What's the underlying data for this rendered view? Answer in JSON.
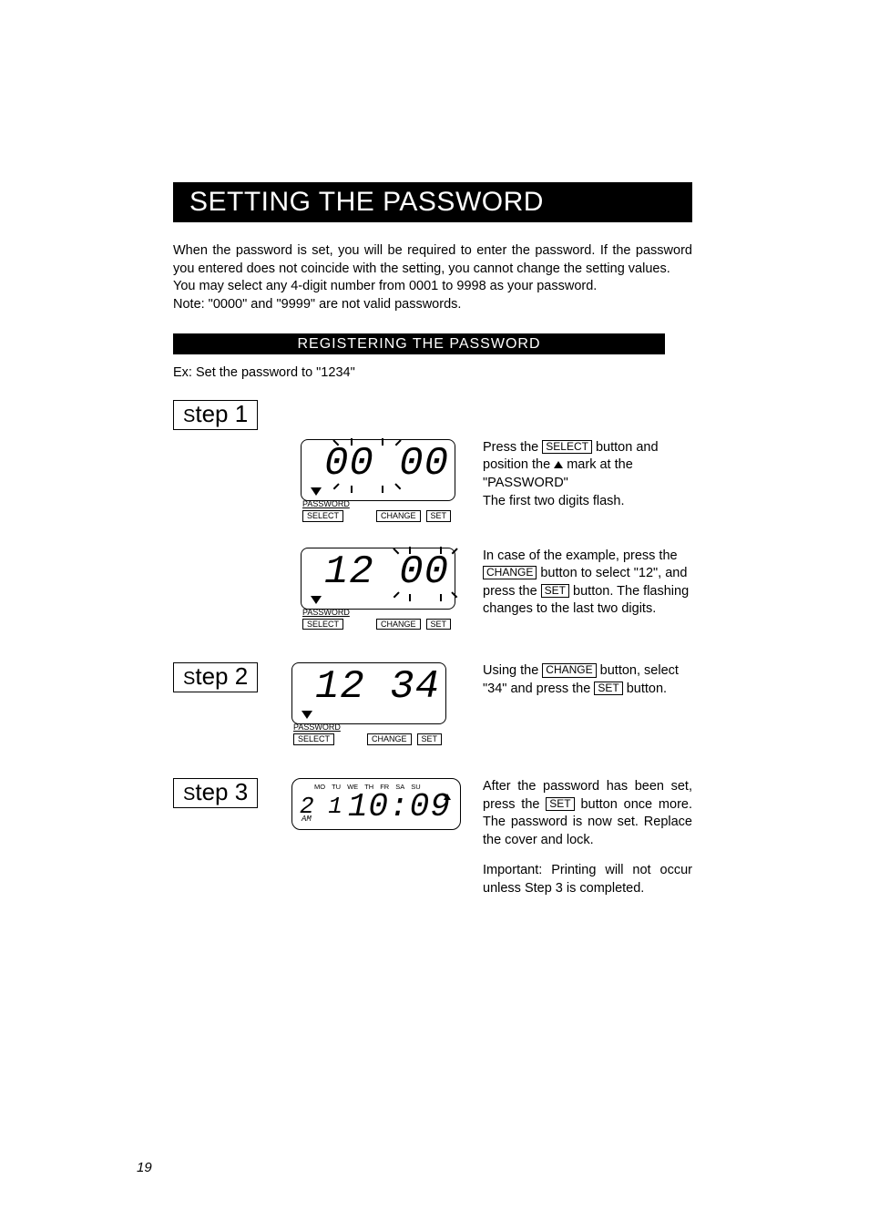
{
  "page_number": "19",
  "title": "SETTING THE PASSWORD",
  "intro": {
    "p1": "When the password is set, you will be required to enter the password. If the password you entered does not coincide with the setting, you cannot change the setting values.",
    "p2": "You may select any 4-digit number from 0001 to 9998 as your password.",
    "p3": "Note: \"0000\" and \"9999\" are not valid passwords."
  },
  "subheading": "REGISTERING THE PASSWORD",
  "example_line": "Ex: Set the password to \"1234\"",
  "steps": {
    "s1_label_prefix": "S",
    "s1_label_rest": "tep 1",
    "s2_label_prefix": "S",
    "s2_label_rest": "tep 2",
    "s3_label_prefix": "S",
    "s3_label_rest": "tep 3"
  },
  "buttons": {
    "select": "SELECT",
    "change": "CHANGE",
    "set": "SET",
    "password": "PASSWORD"
  },
  "lcd": {
    "d1": "00 00",
    "d2": "12 00",
    "d3": "12 34"
  },
  "clock": {
    "days": [
      "MO",
      "TU",
      "WE",
      "TH",
      "FR",
      "SA",
      "SU"
    ],
    "date": "2 1",
    "time": "10:09",
    "ampm": "AM"
  },
  "text": {
    "s1a_pre": "Press the ",
    "s1a_btn": "SELECT",
    "s1a_post": " button and position the ",
    "s1a_post2": " mark at the \"PASSWORD\"",
    "s1a_line3": "The first two digits flash.",
    "s1b_pre": "In case of the example, press the ",
    "s1b_btn1": "CHANGE",
    "s1b_mid": " button to select \"12\", and press the ",
    "s1b_btn2": "SET",
    "s1b_post": " button. The flashing changes to the last two digits.",
    "s2_pre": "Using the ",
    "s2_btn1": "CHANGE",
    "s2_mid": " button, select \"34\" and press the ",
    "s2_btn2": "SET",
    "s2_post": " button.",
    "s3_pre": "After the password has been set, press the ",
    "s3_btn": "SET",
    "s3_post": " button once more. The password is now set. Replace the cover and lock.",
    "s3_note": "Important: Printing will not occur unless Step 3 is completed."
  }
}
